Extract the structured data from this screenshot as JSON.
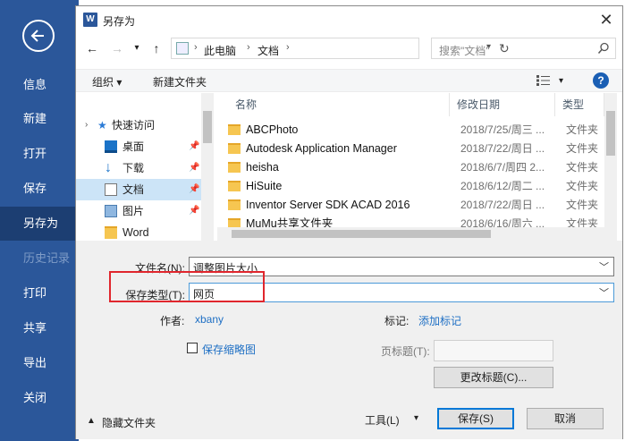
{
  "backstage": {
    "items": [
      {
        "label": "信息"
      },
      {
        "label": "新建"
      },
      {
        "label": "打开"
      },
      {
        "label": "保存"
      },
      {
        "label": "另存为"
      },
      {
        "label": "历史记录"
      },
      {
        "label": "打印"
      },
      {
        "label": "共享"
      },
      {
        "label": "导出"
      },
      {
        "label": "关闭"
      }
    ],
    "active_item": "另存为",
    "colors": {
      "background": "#2b579a",
      "active": "#1c3e72"
    }
  },
  "dialog": {
    "title": "另存为",
    "app_icon_letter": "W",
    "close_glyph": "✕"
  },
  "navigation": {
    "breadcrumbs": [
      "此电脑",
      "文档"
    ],
    "search_placeholder": "搜索\"文档\""
  },
  "toolbar": {
    "organize_label": "组织 ▾",
    "new_folder_label": "新建文件夹",
    "help_glyph": "?"
  },
  "nav_pane": {
    "items": [
      {
        "label": "快速访问",
        "icon": "star-icon",
        "pinned": false
      },
      {
        "label": "桌面",
        "icon": "desktop-icon",
        "pinned": true
      },
      {
        "label": "下载",
        "icon": "download-icon",
        "pinned": true
      },
      {
        "label": "文档",
        "icon": "document-icon",
        "pinned": true,
        "selected": true
      },
      {
        "label": "图片",
        "icon": "picture-icon",
        "pinned": true
      },
      {
        "label": "Word",
        "icon": "folder-icon",
        "pinned": false
      }
    ],
    "pin_glyph": "📌"
  },
  "file_list": {
    "columns": [
      "名称",
      "修改日期",
      "类型"
    ],
    "rows": [
      {
        "name": "ABCPhoto",
        "date": "2018/7/25/周三 ...",
        "type": "文件夹"
      },
      {
        "name": "Autodesk Application Manager",
        "date": "2018/7/22/周日 ...",
        "type": "文件夹"
      },
      {
        "name": "heisha",
        "date": "2018/6/7/周四 2...",
        "type": "文件夹"
      },
      {
        "name": "HiSuite",
        "date": "2018/6/12/周二 ...",
        "type": "文件夹"
      },
      {
        "name": "Inventor Server SDK ACAD 2016",
        "date": "2018/7/22/周日 ...",
        "type": "文件夹"
      },
      {
        "name": "MuMu共享文件夹",
        "date": "2018/6/16/周六 ...",
        "type": "文件夹"
      }
    ]
  },
  "form": {
    "filename_label": "文件名(N):",
    "filename_value": "调整图片大小",
    "savetype_label": "保存类型(T):",
    "savetype_value": "网页",
    "author_label": "作者:",
    "author_value": "xbany",
    "tags_label": "标记:",
    "tags_link": "添加标记",
    "thumbnail_label": "保存缩略图",
    "page_title_label": "页标题(T):",
    "change_title_button": "更改标题(C)...",
    "hide_folders_label": "隐藏文件夹",
    "tools_label": "工具(L)",
    "save_button": "保存(S)",
    "cancel_button": "取消"
  }
}
